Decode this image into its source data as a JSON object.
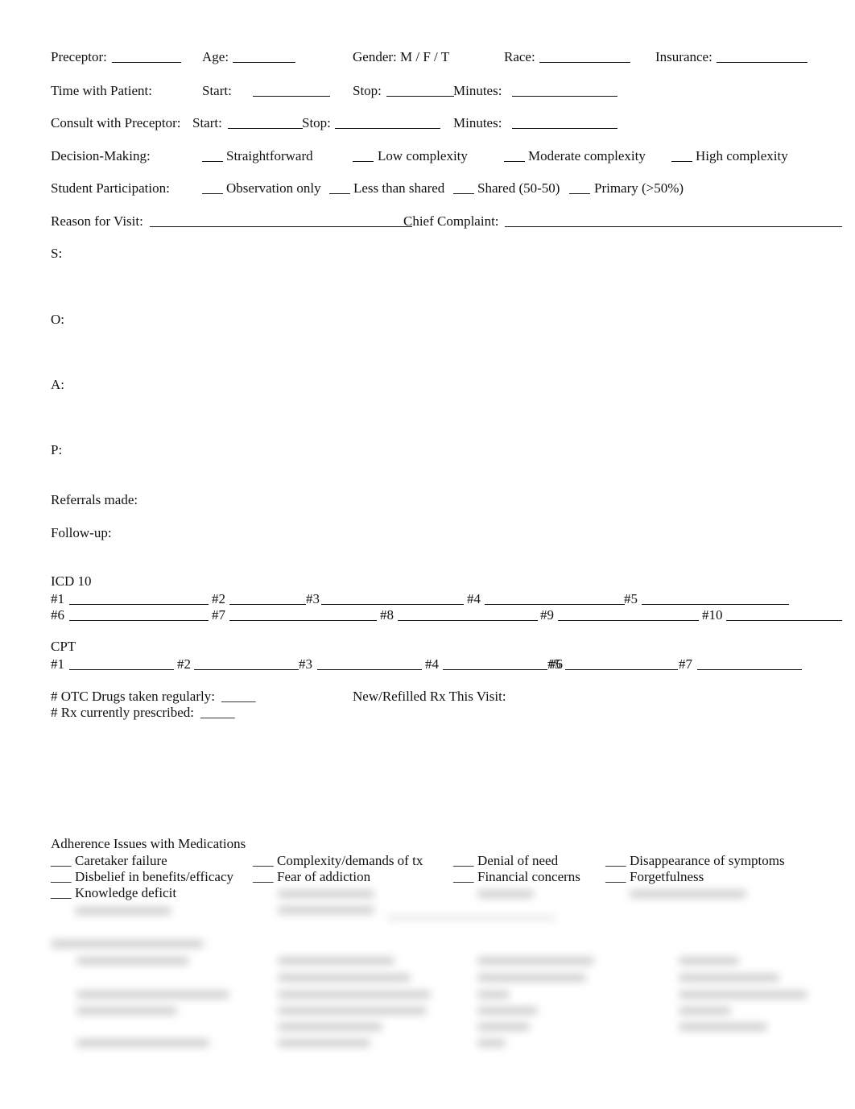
{
  "header": {
    "preceptor": "Preceptor:",
    "age": "Age:",
    "gender": "Gender: M / F / T",
    "race": "Race:",
    "insurance": "Insurance:"
  },
  "time": {
    "label": "Time with Patient:",
    "start": "Start:",
    "stop": "Stop:",
    "minutes": "Minutes:"
  },
  "consult": {
    "label": "Consult  with  Preceptor:",
    "start": "Start:",
    "stop": "Stop:",
    "minutes": "Minutes:"
  },
  "decision": {
    "label": "Decision-Making:",
    "options": [
      "Straightforward",
      "Low complexity",
      "Moderate complexity",
      "High complexity"
    ]
  },
  "participation": {
    "label": "Student Participation:",
    "options": [
      "Observation only",
      "Less than shared",
      "Shared (50-50)",
      "Primary (>50%)"
    ]
  },
  "visit": {
    "reason": "Reason for Visit:",
    "chief": "Chief Complaint:"
  },
  "soap": {
    "s": "S:",
    "o": "O:",
    "a": "A:",
    "p": "P:"
  },
  "referrals": "Referrals made:",
  "followup": "Follow-up:",
  "icd": {
    "title": "ICD 10",
    "labels": [
      "#1",
      "#2",
      "#3",
      "#4",
      "#5",
      "#6",
      "#7",
      "#8",
      "#9",
      "#10"
    ]
  },
  "cpt": {
    "title": "CPT",
    "labels": [
      "#1",
      "#2",
      "#3",
      "#4",
      "#5",
      "#6",
      "#7"
    ]
  },
  "drugs": {
    "otc": "# OTC Drugs taken regularly:",
    "rx": "# Rx currently prescribed:",
    "new_rx": "New/Refilled Rx This Visit:",
    "blank": "_____"
  },
  "adherence": {
    "title": "Adherence Issues with Medications",
    "blank": "___",
    "items": [
      "Caretaker failure",
      "Complexity/demands of tx",
      "Denial of need",
      "Disappearance of symptoms",
      "Disbelief in benefits/efficacy",
      "Fear of addiction",
      "Financial concerns",
      "Forgetfulness",
      "Knowledge deficit"
    ]
  }
}
